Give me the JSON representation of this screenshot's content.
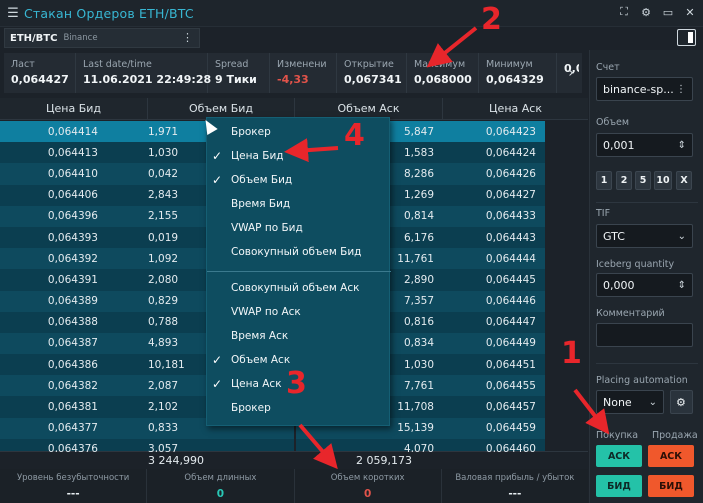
{
  "window": {
    "title": "Стакан Ордеров ETH/BTC",
    "icons": [
      "menu-icon",
      "fullscreen-icon",
      "settings-icon",
      "minimize-icon",
      "close-icon"
    ]
  },
  "instrument": {
    "symbol": "ETH/BTC",
    "exchange": "Binance"
  },
  "stats": [
    {
      "label": "Ласт",
      "value": "0,064427"
    },
    {
      "label": "Last date/time",
      "value": "11.06.2021 22:49:28"
    },
    {
      "label": "Spread",
      "value": "9 Тики"
    },
    {
      "label": "Изменени",
      "value": "-4,33"
    },
    {
      "label": "Открытие",
      "value": "0,067341"
    },
    {
      "label": "Максимум",
      "value": "0,068000"
    },
    {
      "label": "Минимум",
      "value": "0,064329"
    },
    {
      "label": "",
      "value": "0,0"
    }
  ],
  "columns": {
    "bid_price": "Цена Бид",
    "bid_volume": "Объем Бид",
    "ask_volume": "Объем Аск",
    "ask_price": "Цена Аск"
  },
  "rows": [
    {
      "bid_price": "0,064414",
      "bid_volume": "1,971",
      "ask_volume": "5,847",
      "ask_price": "0,064423"
    },
    {
      "bid_price": "0,064413",
      "bid_volume": "1,030",
      "ask_volume": "1,583",
      "ask_price": "0,064424"
    },
    {
      "bid_price": "0,064410",
      "bid_volume": "0,042",
      "ask_volume": "8,286",
      "ask_price": "0,064426"
    },
    {
      "bid_price": "0,064406",
      "bid_volume": "2,843",
      "ask_volume": "1,269",
      "ask_price": "0,064427"
    },
    {
      "bid_price": "0,064396",
      "bid_volume": "2,155",
      "ask_volume": "0,814",
      "ask_price": "0,064433"
    },
    {
      "bid_price": "0,064393",
      "bid_volume": "0,019",
      "ask_volume": "6,176",
      "ask_price": "0,064443"
    },
    {
      "bid_price": "0,064392",
      "bid_volume": "1,092",
      "ask_volume": "11,761",
      "ask_price": "0,064444"
    },
    {
      "bid_price": "0,064391",
      "bid_volume": "2,080",
      "ask_volume": "2,890",
      "ask_price": "0,064445"
    },
    {
      "bid_price": "0,064389",
      "bid_volume": "0,829",
      "ask_volume": "7,357",
      "ask_price": "0,064446"
    },
    {
      "bid_price": "0,064388",
      "bid_volume": "0,788",
      "ask_volume": "0,816",
      "ask_price": "0,064447"
    },
    {
      "bid_price": "0,064387",
      "bid_volume": "4,893",
      "ask_volume": "0,834",
      "ask_price": "0,064449"
    },
    {
      "bid_price": "0,064386",
      "bid_volume": "10,181",
      "ask_volume": "1,030",
      "ask_price": "0,064451"
    },
    {
      "bid_price": "0,064382",
      "bid_volume": "2,087",
      "ask_volume": "7,761",
      "ask_price": "0,064455"
    },
    {
      "bid_price": "0,064381",
      "bid_volume": "2,102",
      "ask_volume": "11,708",
      "ask_price": "0,064457"
    },
    {
      "bid_price": "0,064377",
      "bid_volume": "0,833",
      "ask_volume": "15,139",
      "ask_price": "0,064459"
    },
    {
      "bid_price": "0,064376",
      "bid_volume": "3,057",
      "ask_volume": "4,070",
      "ask_price": "0,064460"
    }
  ],
  "totals": {
    "bid": "3 244,990",
    "ask": "2 059,173"
  },
  "footer": [
    {
      "label": "Уровень безубыточности",
      "value": "---"
    },
    {
      "label": "Объем длинных",
      "value": "0"
    },
    {
      "label": "Объем коротких",
      "value": "0"
    },
    {
      "label": "Валовая прибыль / убыток",
      "value": "---"
    }
  ],
  "side_panel": {
    "account_label": "Счет",
    "account_value": "binance-sp...",
    "volume_label": "Объем",
    "volume_value": "0,001",
    "qty_buttons": [
      "1",
      "2",
      "5",
      "10",
      "X"
    ],
    "tif_label": "TIF",
    "tif_value": "GTC",
    "iceberg_label": "Iceberg quantity",
    "iceberg_value": "0,000",
    "comment_label": "Комментарий",
    "comment_value": "",
    "automation_label": "Placing automation",
    "automation_value": "None",
    "buy_label": "Покупка",
    "sell_label": "Продажа",
    "buy_ask": "АСК",
    "sell_ask": "АСК",
    "buy_bid": "БИД",
    "sell_bid": "БИД"
  },
  "context_menu": [
    {
      "label": "Брокер",
      "checked": false
    },
    {
      "label": "Цена Бид",
      "checked": true
    },
    {
      "label": "Объем Бид",
      "checked": true
    },
    {
      "label": "Время Бид",
      "checked": false
    },
    {
      "label": "VWAP по Бид",
      "checked": false
    },
    {
      "label": "Совокупный объем Бид",
      "checked": false
    },
    {
      "label": "Совокупный объем Аск",
      "checked": false
    },
    {
      "label": "VWAP по Аск",
      "checked": false
    },
    {
      "label": "Время Аск",
      "checked": false
    },
    {
      "label": "Объем Аск",
      "checked": true
    },
    {
      "label": "Цена Аск",
      "checked": true
    },
    {
      "label": "Брокер",
      "checked": false
    }
  ],
  "annotations": [
    "1",
    "2",
    "3",
    "4"
  ],
  "colors": {
    "accent": "#38b7d3",
    "bid_row": "#0e4a5e",
    "selected_row": "#0f7fa0",
    "buy": "#24c2a8",
    "sell": "#f0582c",
    "annotation": "#e8262b"
  }
}
